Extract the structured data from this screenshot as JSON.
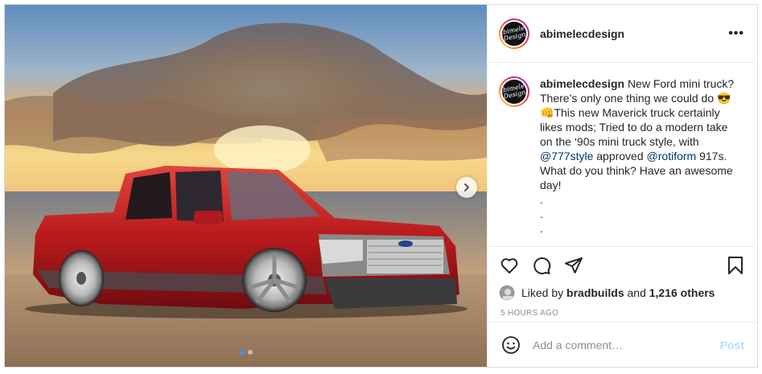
{
  "post": {
    "username": "abimelecdesign",
    "avatar_text": "Abimelec Design",
    "more_icon": "more-horizontal-icon",
    "caption": {
      "user": "abimelecdesign",
      "part1": "New Ford mini truck? There’s only one thing we could do ",
      "emoji": "😎👊",
      "part2": "This new Maverick truck certainly likes mods; Tried to do a modern take on the ‘90s mini truck style, with ",
      "mention1": "@777style",
      "part3": " approved ",
      "mention2": "@rotiform",
      "part4": " 917s. What do you think? Have an awesome day!",
      "dots": [
        ".",
        ".",
        "."
      ]
    },
    "likes": {
      "prefix": "Liked by ",
      "user": "bradbuilds",
      "middle": " and ",
      "count": "1,216 others"
    },
    "time": "5 HOURS AGO",
    "comment": {
      "placeholder": "Add a comment…",
      "post_label": "Post"
    },
    "carousel": {
      "slides": 2,
      "active": 1
    },
    "icons": [
      "heart-icon",
      "comment-icon",
      "share-icon",
      "bookmark-icon",
      "emoji-icon",
      "chevron-right-icon"
    ],
    "colors": {
      "accent_link": "#00376b",
      "post_button": "#b3dbff",
      "secondary_text": "#8e8e8e",
      "carousel_active": "#3897f0"
    }
  }
}
